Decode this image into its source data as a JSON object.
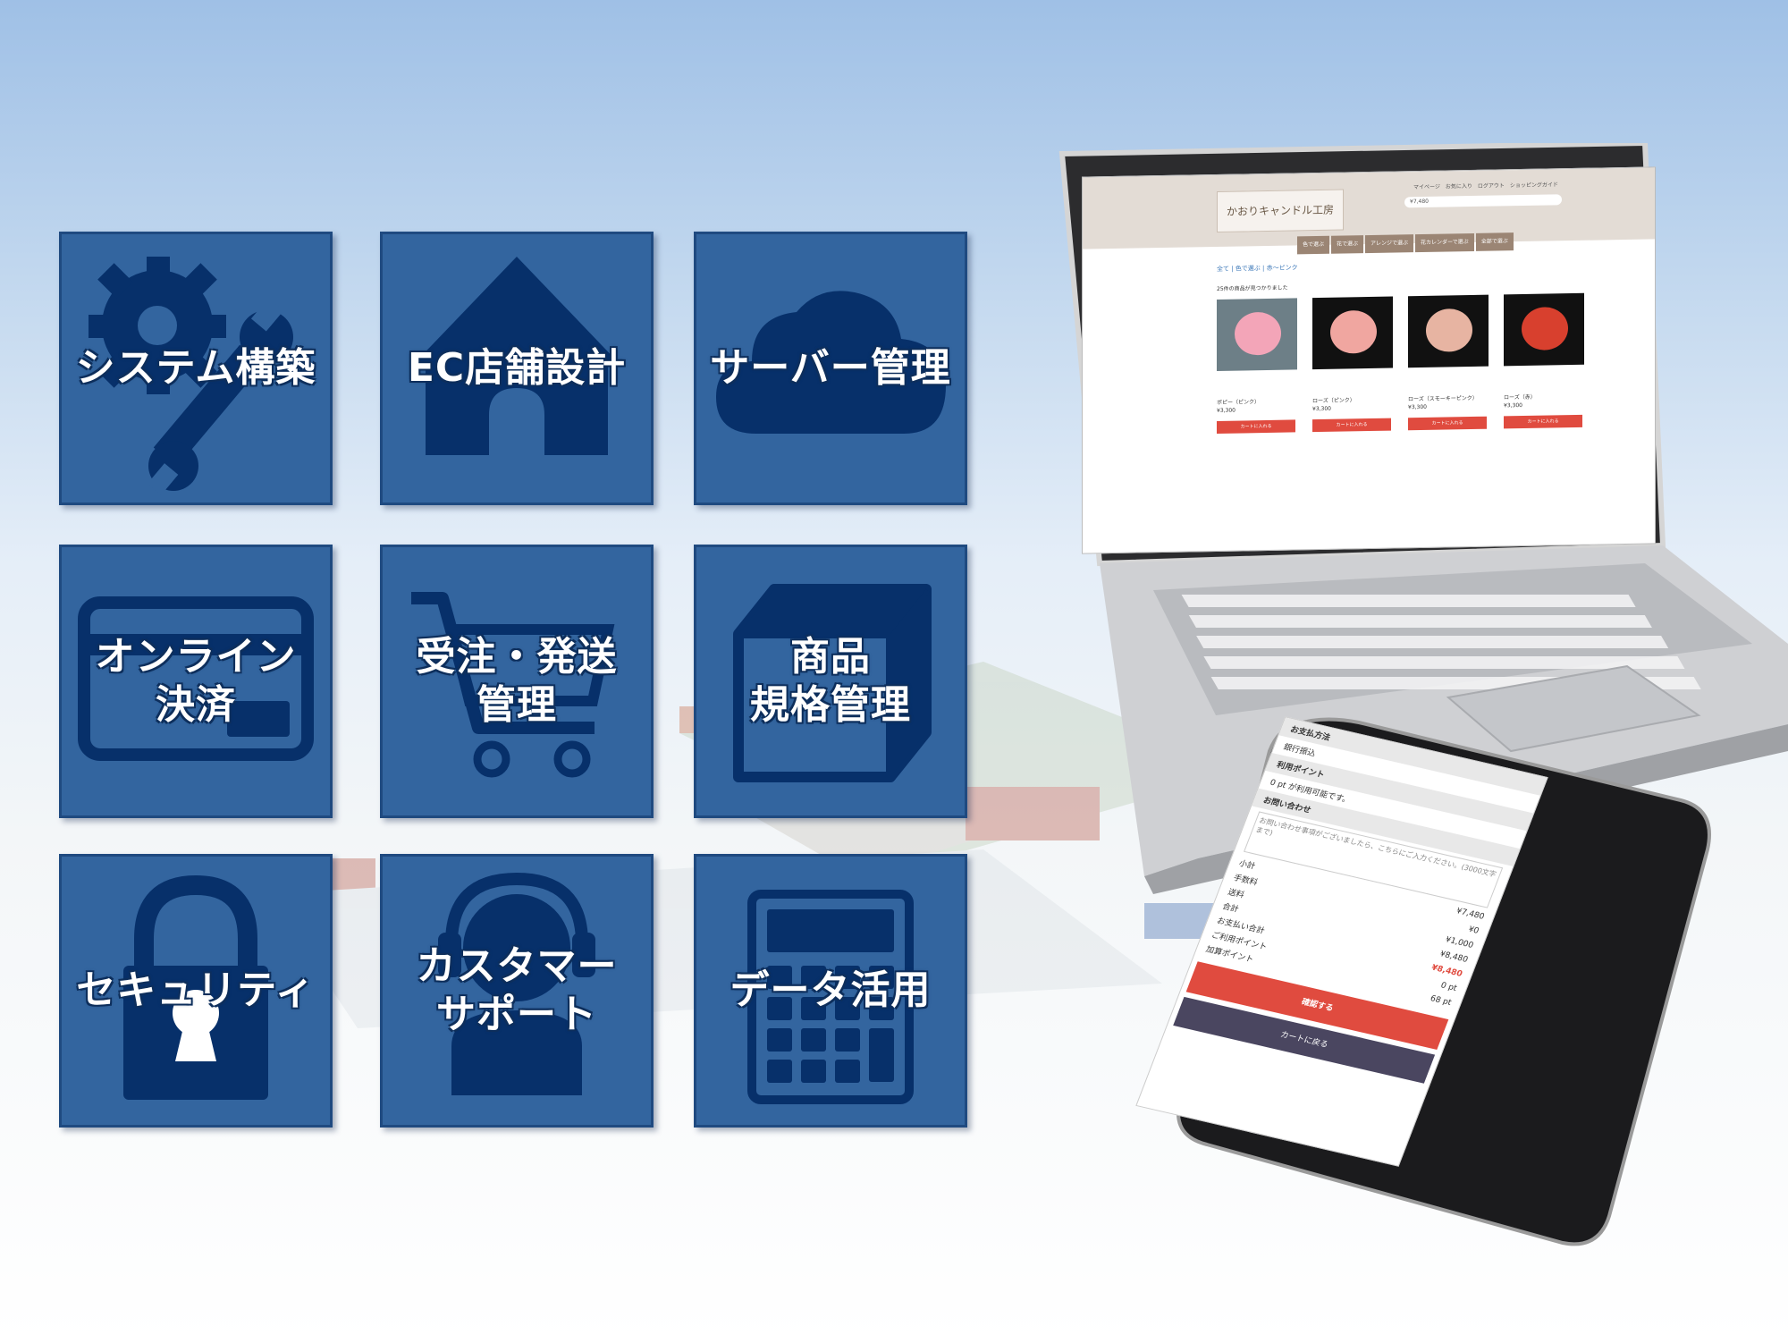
{
  "tiles": [
    {
      "label": "システム構築",
      "icon": "gear-wrench-icon"
    },
    {
      "label": "EC店舗設計",
      "icon": "house-icon"
    },
    {
      "label": "サーバー管理",
      "icon": "cloud-icon"
    },
    {
      "label": "オンライン\n決済",
      "icon": "credit-card-icon"
    },
    {
      "label": "受注・発送\n管理",
      "icon": "shopping-cart-icon"
    },
    {
      "label": "商品\n規格管理",
      "icon": "box-icon"
    },
    {
      "label": "セキュリティ",
      "icon": "padlock-icon"
    },
    {
      "label": "カスタマー\nサポート",
      "icon": "headset-person-icon"
    },
    {
      "label": "データ活用",
      "icon": "calculator-icon"
    }
  ],
  "laptop": {
    "shop_name": "かおりキャンドル工房",
    "nav": "マイページ　お気に入り　ログアウト　ショッピングガイド",
    "search_value": "¥7,480",
    "menu": [
      "色で選ぶ",
      "花で選ぶ",
      "アレンジで選ぶ",
      "花カレンダーで選ぶ",
      "全部で選ぶ"
    ],
    "breadcrumb": "全て | 色で選ぶ | 赤～ピンク",
    "result_count": "25件の商品が見つかりました",
    "products": [
      {
        "name": "ポピー（ピンク）",
        "price": "¥3,300",
        "button": "カートに入れる",
        "color": "#f3a5b8"
      },
      {
        "name": "ローズ（ピンク）",
        "price": "¥3,300",
        "button": "カートに入れる",
        "color": "#f0a6a0"
      },
      {
        "name": "ローズ（スモーキーピンク）",
        "price": "¥3,300",
        "button": "カートに入れる",
        "color": "#e7b4a2"
      },
      {
        "name": "ローズ（赤）",
        "price": "¥3,300",
        "button": "カートに入れる",
        "color": "#d8402e"
      }
    ]
  },
  "phone": {
    "payment_heading": "お支払方法",
    "payment_value": "銀行振込",
    "points_heading": "利用ポイント",
    "points_note": "0 pt が利用可能です。",
    "contact_heading": "お問い合わせ",
    "contact_placeholder": "お問い合わせ事項がございましたら、こちらにご入力ください。(3000文字まで)",
    "subtotal_label": "小計",
    "subtotal_value": "¥7,480",
    "fee_label": "手数料",
    "fee_value": "¥0",
    "shipping_label": "送料",
    "shipping_value": "¥1,000",
    "total_label": "合計",
    "total_value": "¥8,480",
    "payment_total_label": "お支払い合計",
    "payment_total_value": "¥8,480",
    "used_points_label": "ご利用ポイント",
    "used_points_value": "0 pt",
    "added_points_label": "加算ポイント",
    "added_points_value": "68 pt",
    "confirm_button": "確認する",
    "back_button": "カートに戻る"
  },
  "colors": {
    "tile": "#33659f",
    "tile_icon": "#07306a",
    "accent_red": "#e04b3f"
  }
}
